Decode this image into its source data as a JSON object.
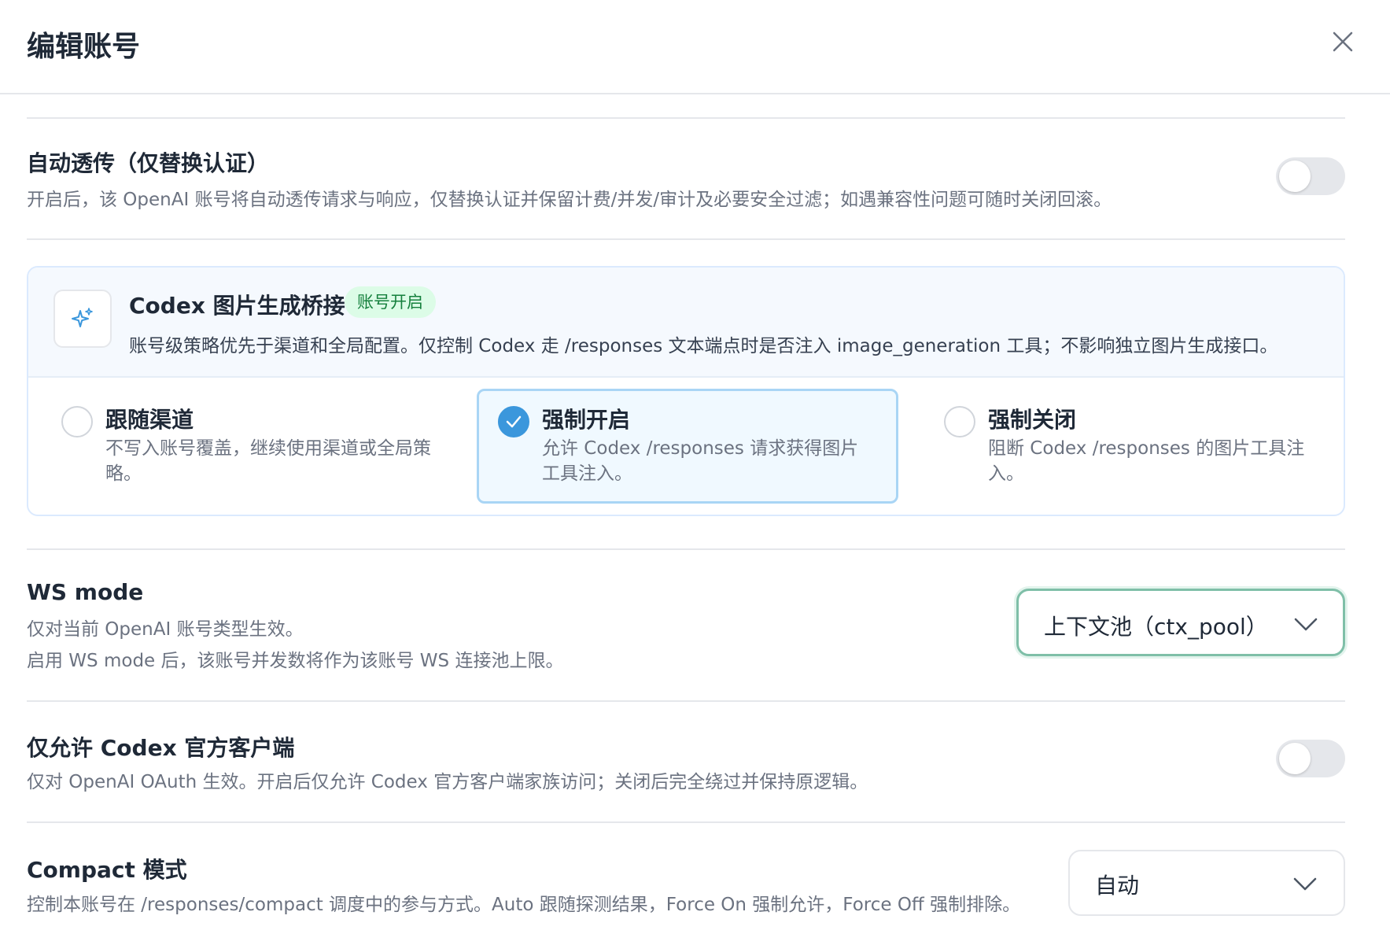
{
  "header": {
    "title": "编辑账号"
  },
  "passthrough": {
    "title": "自动透传（仅替换认证）",
    "desc": "开启后，该 OpenAI 账号将自动透传请求与响应，仅替换认证并保留计费/并发/审计及必要安全过滤；如遇兼容性问题可随时关闭回滚。",
    "enabled": false
  },
  "codex": {
    "title": "Codex 图片生成桥接",
    "badge": "账号开启",
    "desc": "账号级策略优先于渠道和全局配置。仅控制 Codex 走 /responses 文本端点时是否注入 image_generation 工具；不影响独立图片生成接口。",
    "icon": "sparkles-icon",
    "options": [
      {
        "title": "跟随渠道",
        "desc": "不写入账号覆盖，继续使用渠道或全局策略。",
        "selected": false
      },
      {
        "title": "强制开启",
        "desc": "允许 Codex /responses 请求获得图片工具注入。",
        "selected": true
      },
      {
        "title": "强制关闭",
        "desc": "阻断 Codex /responses 的图片工具注入。",
        "selected": false
      }
    ]
  },
  "ws_mode": {
    "title": "WS mode",
    "desc1": "仅对当前 OpenAI 账号类型生效。",
    "desc2": "启用 WS mode 后，该账号并发数将作为该账号 WS 连接池上限。",
    "value": "上下文池（ctx_pool）"
  },
  "codex_client": {
    "title": "仅允许 Codex 官方客户端",
    "desc": "仅对 OpenAI OAuth 生效。开启后仅允许 Codex 官方客户端家族访问；关闭后完全绕过并保持原逻辑。",
    "enabled": false
  },
  "compact": {
    "title": "Compact 模式",
    "desc": "控制本账号在 /responses/compact 调度中的参与方式。Auto 跟随探测结果，Force On 强制允许，Force Off 强制排除。",
    "value": "自动"
  },
  "colors": {
    "accent": "#3b97dc",
    "badge_bg": "#dcfce7",
    "badge_text": "#15803d",
    "focus_border": "#7fbfa8"
  }
}
